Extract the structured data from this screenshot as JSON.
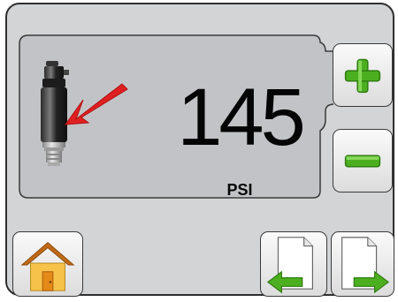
{
  "display": {
    "value": "145",
    "unit": "PSI"
  },
  "buttons": {
    "increase": "plus-icon",
    "decrease": "minus-icon",
    "home": "home-icon",
    "previous": "previous-page-icon",
    "next": "next-page-icon"
  },
  "colors": {
    "panel_background": "#d3d4d6",
    "display_background": "#c2c3c6",
    "accent_green": "#4caf1f",
    "arrow_red": "#e02020",
    "text": "#050505"
  }
}
